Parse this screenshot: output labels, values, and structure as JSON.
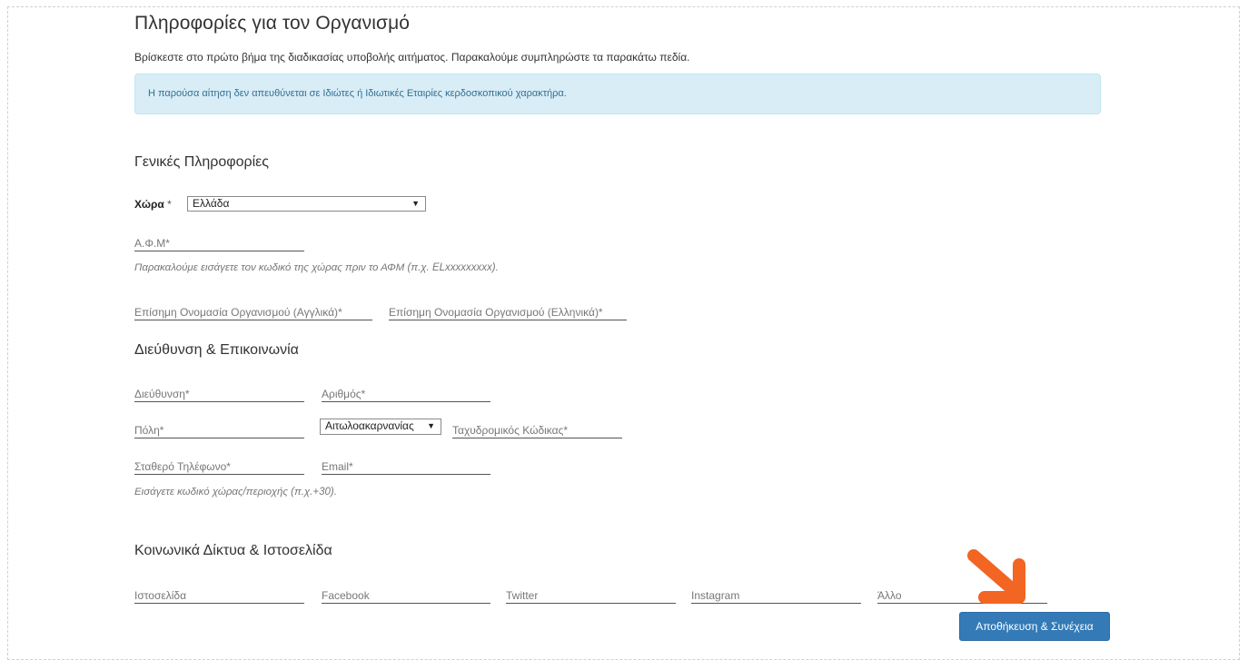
{
  "page": {
    "title": "Πληροφορίες για τον Οργανισμό",
    "subtitle": "Βρίσκεστε στο πρώτο βήμα της διαδικασίας υποβολής αιτήματος. Παρακαλούμε συμπληρώστε τα παρακάτω πεδία.",
    "alert": "Η παρούσα αίτηση δεν απευθύνεται σε Ιδιώτες ή Ιδιωτικές Εταιρίες κερδοσκοπικού χαρακτήρα."
  },
  "general": {
    "heading": "Γενικές Πληροφορίες",
    "country_label": "Χώρα",
    "required_mark": "*",
    "country_value": "Ελλάδα",
    "vat_placeholder": "Α.Φ.Μ*",
    "vat_help": "Παρακαλούμε εισάγετε τον κωδικό της χώρας πριν το ΑΦΜ (π.χ. ELxxxxxxxxx).",
    "name_en_placeholder": "Επίσημη Ονομασία Οργανισμού (Αγγλικά)*",
    "name_el_placeholder": "Επίσημη Ονομασία Οργανισμού (Ελληνικά)*"
  },
  "address": {
    "heading": "Διεύθυνση & Επικοινωνία",
    "street_placeholder": "Διεύθυνση*",
    "number_placeholder": "Αριθμός*",
    "city_placeholder": "Πόλη*",
    "region_value": "Αιτωλοακαρνανίας",
    "postal_placeholder": "Ταχυδρομικός Κώδικας*",
    "phone_placeholder": "Σταθερό Τηλέφωνο*",
    "email_placeholder": "Email*",
    "phone_help": "Εισάγετε κωδικό χώρας/περιοχής (π.χ.+30)."
  },
  "social": {
    "heading": "Κοινωνικά Δίκτυα & Ιστοσελίδα",
    "website_placeholder": "Ιστοσελίδα",
    "facebook_placeholder": "Facebook",
    "twitter_placeholder": "Twitter",
    "instagram_placeholder": "Instagram",
    "other_placeholder": "Άλλο"
  },
  "actions": {
    "save_continue": "Αποθήκευση & Συνέχεια"
  },
  "icons": {
    "select_arrow": "▼",
    "annotation_arrow": "arrow-down-right-icon"
  },
  "colors": {
    "primary": "#337ab7",
    "alert_bg": "#d9edf7",
    "alert_text": "#31708f",
    "annotation": "#f26522"
  }
}
